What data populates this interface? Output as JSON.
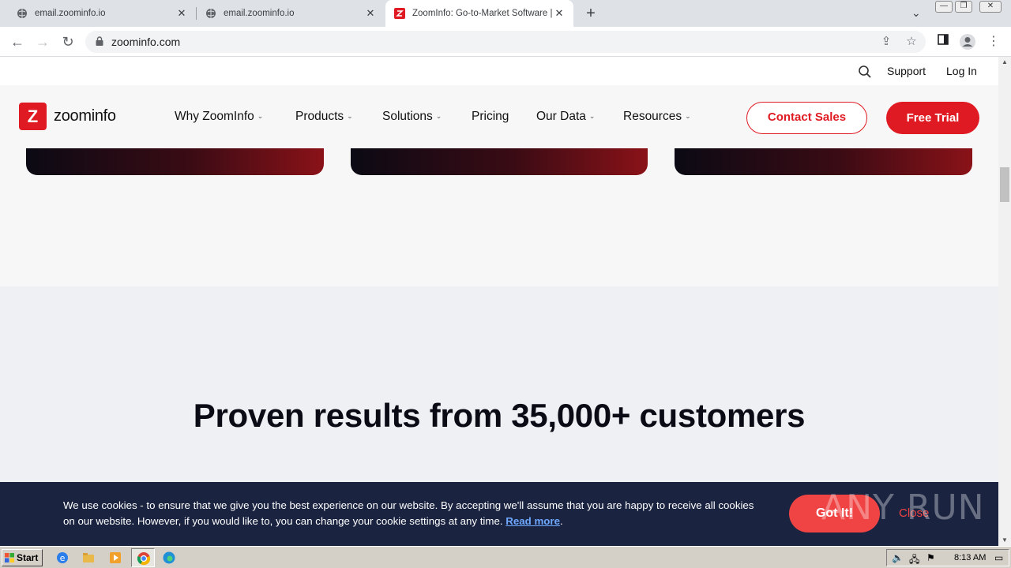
{
  "browser": {
    "tabs": [
      {
        "title": "email.zoominfo.io",
        "active": false
      },
      {
        "title": "email.zoominfo.io",
        "active": false
      },
      {
        "title": "ZoomInfo: Go-to-Market Software |",
        "active": true
      }
    ],
    "url": "zoominfo.com"
  },
  "utility": {
    "support": "Support",
    "login": "Log In"
  },
  "nav": {
    "logo_text": "zoominfo",
    "logo_mark": "Z",
    "items": [
      "Why ZoomInfo",
      "Products",
      "Solutions",
      "Pricing",
      "Our Data",
      "Resources"
    ],
    "contact": "Contact Sales",
    "trial": "Free Trial"
  },
  "results": {
    "title": "Proven results from 35,000+ customers"
  },
  "cookie": {
    "text": "We use cookies - to ensure that we give you the best experience on our website. By accepting we'll assume that you are happy to receive all cookies on our website. However, if you would like to, you can change your cookie settings at any time.",
    "read_more": "Read more",
    "gotit": "Got It!",
    "close": "Close",
    "watermark": "ANY RUN"
  },
  "taskbar": {
    "start": "Start",
    "clock": "8:13 AM"
  },
  "colors": {
    "brand_red": "#e01a22",
    "cookie_bg": "#1a2340"
  }
}
